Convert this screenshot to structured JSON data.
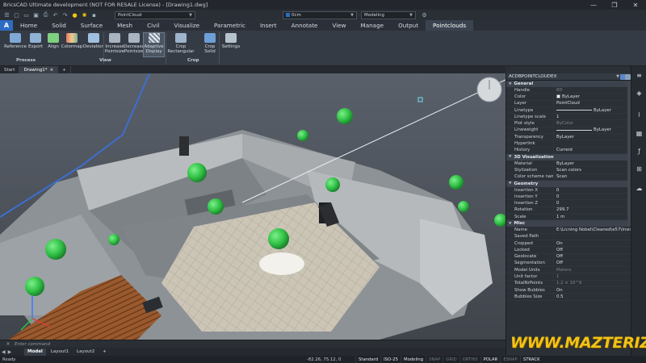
{
  "window": {
    "title": "BricsCAD Ultimate development (NOT FOR RESALE License) - [Drawing1.dwg]",
    "controls": [
      "—",
      "❐",
      "✕"
    ]
  },
  "quick_access": {
    "layer_combo": "PointCloud",
    "visual_combo": "0cm",
    "workspace_combo": "Modeling"
  },
  "ribbon_tabs": [
    "Home",
    "Solid",
    "Surface",
    "Mesh",
    "Civil",
    "Visualize",
    "Parametric",
    "Insert",
    "Annotate",
    "View",
    "Manage",
    "Output",
    "Pointclouds"
  ],
  "active_tab": "Pointclouds",
  "app_logo": "A",
  "ribbon": {
    "buttons": [
      {
        "label": "Reference",
        "color": "#7fa8d8"
      },
      {
        "label": "Export",
        "color": "#8fb2d6"
      },
      {
        "label": "Align",
        "color": "#7fd07f"
      },
      {
        "label": "Colormap",
        "color": "#e07a5f"
      },
      {
        "label": "Deviation",
        "color": "#9fc0e0"
      },
      {
        "label": "Increase Pointsize",
        "color": "#a8b4c2"
      },
      {
        "label": "Decrease Pointsize",
        "color": "#a8b4c2"
      },
      {
        "label": "Adaptive Display",
        "color": "#c8d2de"
      },
      {
        "label": "Crop Rectangular",
        "color": "#9db4cc"
      },
      {
        "label": "Crop Solid",
        "color": "#6d9fd6"
      },
      {
        "label": "Settings",
        "color": "#b7c2cf"
      }
    ],
    "groups": [
      "Process",
      "View",
      "Crop"
    ]
  },
  "doc_tabs": {
    "start": "Start",
    "drawing": "Drawing1*",
    "close": "×",
    "add": "+"
  },
  "command_line": {
    "placeholder": "Enter command",
    "close": "×"
  },
  "layout_tabs": [
    "Model",
    "Layout1",
    "Layout2",
    "+"
  ],
  "status": {
    "ready": "Ready",
    "coords": "-82.26, 75.12, 0",
    "items": [
      {
        "label": "Standard",
        "state": "on"
      },
      {
        "label": "ISO-25",
        "state": "on"
      },
      {
        "label": "Modeling",
        "state": "on"
      },
      {
        "label": "SNAP",
        "state": "off"
      },
      {
        "label": "GRID",
        "state": "off"
      },
      {
        "label": "ORTHO",
        "state": "off"
      },
      {
        "label": "POLAR",
        "state": "on"
      },
      {
        "label": "ESNAP",
        "state": "off"
      },
      {
        "label": "STRACK",
        "state": "on"
      }
    ]
  },
  "properties": {
    "header": "ACDBPOINTCLOUDEX",
    "sections": [
      {
        "name": "General",
        "rows": [
          {
            "k": "Handle",
            "v": "6D",
            "dim": true
          },
          {
            "k": "Color",
            "v": "ByLayer",
            "swatch": true
          },
          {
            "k": "Layer",
            "v": "PointCloud"
          },
          {
            "k": "Linetype",
            "v": "ByLayer",
            "line": true
          },
          {
            "k": "Linetype scale",
            "v": "1"
          },
          {
            "k": "Plot style",
            "v": "ByColor",
            "dim": true
          },
          {
            "k": "Lineweight",
            "v": "ByLayer",
            "line": true
          },
          {
            "k": "Transparency",
            "v": "ByLayer"
          },
          {
            "k": "Hyperlink",
            "v": ""
          },
          {
            "k": "History",
            "v": "Current"
          }
        ]
      },
      {
        "name": "3D Visualization",
        "rows": [
          {
            "k": "Material",
            "v": "ByLayer"
          },
          {
            "k": "Stylization",
            "v": "Scan colors"
          },
          {
            "k": "Color scheme name",
            "v": "Scan"
          }
        ]
      },
      {
        "name": "Geometry",
        "rows": [
          {
            "k": "Insertion X",
            "v": "0"
          },
          {
            "k": "Insertion Y",
            "v": "0"
          },
          {
            "k": "Insertion Z",
            "v": "0"
          },
          {
            "k": "Rotation",
            "v": "299.7"
          },
          {
            "k": "Scale",
            "v": "1 m"
          }
        ]
      },
      {
        "name": "Misc",
        "rows": [
          {
            "k": "Name",
            "v": "E:\\Licning Nobel\\Cleaned\\e57\\Insid"
          },
          {
            "k": "Saved Path",
            "v": ""
          },
          {
            "k": "Cropped",
            "v": "On"
          },
          {
            "k": "Locked",
            "v": "Off"
          },
          {
            "k": "Geolocate",
            "v": "Off"
          },
          {
            "k": "Segmentation",
            "v": "Off"
          },
          {
            "k": "Model Units",
            "v": "Meters",
            "dim": true
          },
          {
            "k": "Unit factor",
            "v": "1",
            "dim": true
          },
          {
            "k": "TotalNrPoints",
            "v": "1.2 × 10^9",
            "dim": true
          },
          {
            "k": "Show Bubbles",
            "v": "On"
          },
          {
            "k": "Bubbles Size",
            "v": "0.5"
          }
        ]
      }
    ]
  },
  "sidebar_icons": [
    "sliders-icon",
    "layers-icon",
    "attach-icon",
    "grid-icon",
    "function-icon",
    "structure-icon",
    "cloud-upload-icon"
  ],
  "watermark": "WWW.MAZTERIZES.COM",
  "colors": {
    "accent": "#2d6cc4",
    "bubble": "#2fbf44",
    "watermark": "#f2c316"
  }
}
